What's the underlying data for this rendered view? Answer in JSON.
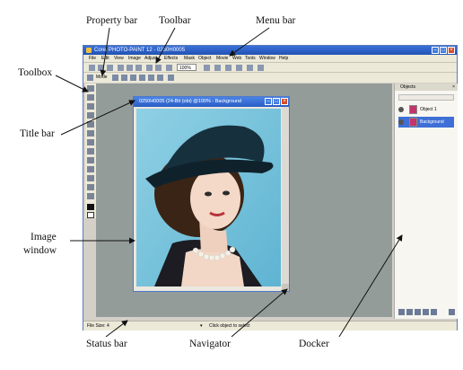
{
  "callouts": {
    "property_bar": "Property bar",
    "toolbar": "Toolbar",
    "menu_bar": "Menu bar",
    "toolbox": "Toolbox",
    "title_bar": "Title bar",
    "image_window_line1": "Image",
    "image_window_line2": "window",
    "status_bar": "Status bar",
    "navigator": "Navigator",
    "docker": "Docker"
  },
  "app": {
    "title": "Corel PHOTO-PAINT 12 - 0250H0005",
    "menu": [
      "File",
      "Edit",
      "View",
      "Image",
      "Adjust",
      "Effects",
      "Mask",
      "Object",
      "Movie",
      "Web",
      "Tools",
      "Window",
      "Help"
    ],
    "toolbar_zoom": "100%",
    "property_mode_label": "Mode",
    "status_left": "File Size: 4",
    "status_right": "Click object to select"
  },
  "image_window": {
    "title": "0250H0005 (24-Bit (obi) @100% - Background"
  },
  "docker": {
    "title": "Objects",
    "layers": [
      "Object 1",
      "Background"
    ]
  }
}
